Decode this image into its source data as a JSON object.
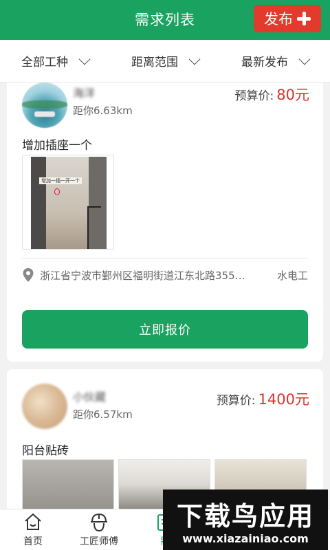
{
  "header": {
    "title": "需求列表",
    "publish_label": "发布"
  },
  "filters": [
    {
      "label": "全部工种"
    },
    {
      "label": "距离范围"
    },
    {
      "label": "最新发布"
    }
  ],
  "cards": [
    {
      "user_name": "海洋",
      "distance": "距你6.63km",
      "price_label": "预算价:",
      "price_value": "80元",
      "title": "增加插座一个",
      "photo_caption": "增加一插一开一个",
      "address": "浙江省宁波市鄞州区福明街道江东北路355…",
      "trade": "水电工",
      "action_label": "立即报价"
    },
    {
      "user_name": "小伙藏",
      "distance": "距你6.57km",
      "price_label": "预算价:",
      "price_value": "1400元",
      "title": "阳台贴砖"
    }
  ],
  "nav": [
    {
      "label": "首页",
      "icon": "home-icon"
    },
    {
      "label": "工匠师傅",
      "icon": "worker-helmet-icon"
    },
    {
      "label": "需",
      "icon": "demand-list-icon"
    }
  ],
  "watermark": {
    "title": "下载鸟应用",
    "url": "www.xiazainiao.com"
  },
  "colors": {
    "primary": "#1aa260",
    "accent_red": "#e23a2c",
    "price_red": "#d9342b"
  }
}
